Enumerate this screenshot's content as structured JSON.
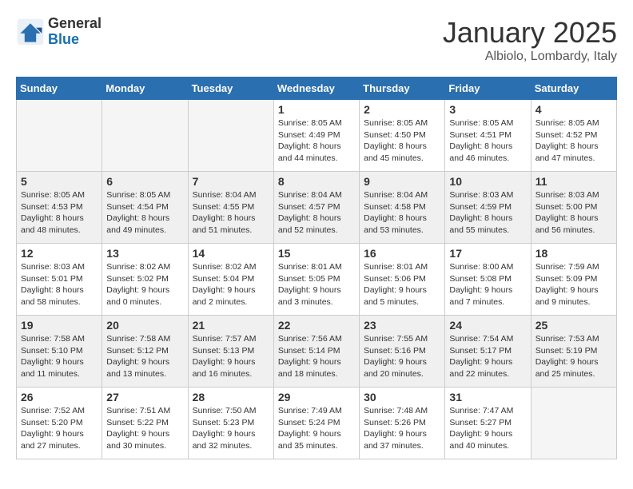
{
  "header": {
    "logo_general": "General",
    "logo_blue": "Blue",
    "title": "January 2025",
    "location": "Albiolo, Lombardy, Italy"
  },
  "weekdays": [
    "Sunday",
    "Monday",
    "Tuesday",
    "Wednesday",
    "Thursday",
    "Friday",
    "Saturday"
  ],
  "weeks": [
    [
      {
        "day": "",
        "info": ""
      },
      {
        "day": "",
        "info": ""
      },
      {
        "day": "",
        "info": ""
      },
      {
        "day": "1",
        "info": "Sunrise: 8:05 AM\nSunset: 4:49 PM\nDaylight: 8 hours\nand 44 minutes."
      },
      {
        "day": "2",
        "info": "Sunrise: 8:05 AM\nSunset: 4:50 PM\nDaylight: 8 hours\nand 45 minutes."
      },
      {
        "day": "3",
        "info": "Sunrise: 8:05 AM\nSunset: 4:51 PM\nDaylight: 8 hours\nand 46 minutes."
      },
      {
        "day": "4",
        "info": "Sunrise: 8:05 AM\nSunset: 4:52 PM\nDaylight: 8 hours\nand 47 minutes."
      }
    ],
    [
      {
        "day": "5",
        "info": "Sunrise: 8:05 AM\nSunset: 4:53 PM\nDaylight: 8 hours\nand 48 minutes."
      },
      {
        "day": "6",
        "info": "Sunrise: 8:05 AM\nSunset: 4:54 PM\nDaylight: 8 hours\nand 49 minutes."
      },
      {
        "day": "7",
        "info": "Sunrise: 8:04 AM\nSunset: 4:55 PM\nDaylight: 8 hours\nand 51 minutes."
      },
      {
        "day": "8",
        "info": "Sunrise: 8:04 AM\nSunset: 4:57 PM\nDaylight: 8 hours\nand 52 minutes."
      },
      {
        "day": "9",
        "info": "Sunrise: 8:04 AM\nSunset: 4:58 PM\nDaylight: 8 hours\nand 53 minutes."
      },
      {
        "day": "10",
        "info": "Sunrise: 8:03 AM\nSunset: 4:59 PM\nDaylight: 8 hours\nand 55 minutes."
      },
      {
        "day": "11",
        "info": "Sunrise: 8:03 AM\nSunset: 5:00 PM\nDaylight: 8 hours\nand 56 minutes."
      }
    ],
    [
      {
        "day": "12",
        "info": "Sunrise: 8:03 AM\nSunset: 5:01 PM\nDaylight: 8 hours\nand 58 minutes."
      },
      {
        "day": "13",
        "info": "Sunrise: 8:02 AM\nSunset: 5:02 PM\nDaylight: 9 hours\nand 0 minutes."
      },
      {
        "day": "14",
        "info": "Sunrise: 8:02 AM\nSunset: 5:04 PM\nDaylight: 9 hours\nand 2 minutes."
      },
      {
        "day": "15",
        "info": "Sunrise: 8:01 AM\nSunset: 5:05 PM\nDaylight: 9 hours\nand 3 minutes."
      },
      {
        "day": "16",
        "info": "Sunrise: 8:01 AM\nSunset: 5:06 PM\nDaylight: 9 hours\nand 5 minutes."
      },
      {
        "day": "17",
        "info": "Sunrise: 8:00 AM\nSunset: 5:08 PM\nDaylight: 9 hours\nand 7 minutes."
      },
      {
        "day": "18",
        "info": "Sunrise: 7:59 AM\nSunset: 5:09 PM\nDaylight: 9 hours\nand 9 minutes."
      }
    ],
    [
      {
        "day": "19",
        "info": "Sunrise: 7:58 AM\nSunset: 5:10 PM\nDaylight: 9 hours\nand 11 minutes."
      },
      {
        "day": "20",
        "info": "Sunrise: 7:58 AM\nSunset: 5:12 PM\nDaylight: 9 hours\nand 13 minutes."
      },
      {
        "day": "21",
        "info": "Sunrise: 7:57 AM\nSunset: 5:13 PM\nDaylight: 9 hours\nand 16 minutes."
      },
      {
        "day": "22",
        "info": "Sunrise: 7:56 AM\nSunset: 5:14 PM\nDaylight: 9 hours\nand 18 minutes."
      },
      {
        "day": "23",
        "info": "Sunrise: 7:55 AM\nSunset: 5:16 PM\nDaylight: 9 hours\nand 20 minutes."
      },
      {
        "day": "24",
        "info": "Sunrise: 7:54 AM\nSunset: 5:17 PM\nDaylight: 9 hours\nand 22 minutes."
      },
      {
        "day": "25",
        "info": "Sunrise: 7:53 AM\nSunset: 5:19 PM\nDaylight: 9 hours\nand 25 minutes."
      }
    ],
    [
      {
        "day": "26",
        "info": "Sunrise: 7:52 AM\nSunset: 5:20 PM\nDaylight: 9 hours\nand 27 minutes."
      },
      {
        "day": "27",
        "info": "Sunrise: 7:51 AM\nSunset: 5:22 PM\nDaylight: 9 hours\nand 30 minutes."
      },
      {
        "day": "28",
        "info": "Sunrise: 7:50 AM\nSunset: 5:23 PM\nDaylight: 9 hours\nand 32 minutes."
      },
      {
        "day": "29",
        "info": "Sunrise: 7:49 AM\nSunset: 5:24 PM\nDaylight: 9 hours\nand 35 minutes."
      },
      {
        "day": "30",
        "info": "Sunrise: 7:48 AM\nSunset: 5:26 PM\nDaylight: 9 hours\nand 37 minutes."
      },
      {
        "day": "31",
        "info": "Sunrise: 7:47 AM\nSunset: 5:27 PM\nDaylight: 9 hours\nand 40 minutes."
      },
      {
        "day": "",
        "info": ""
      }
    ]
  ]
}
